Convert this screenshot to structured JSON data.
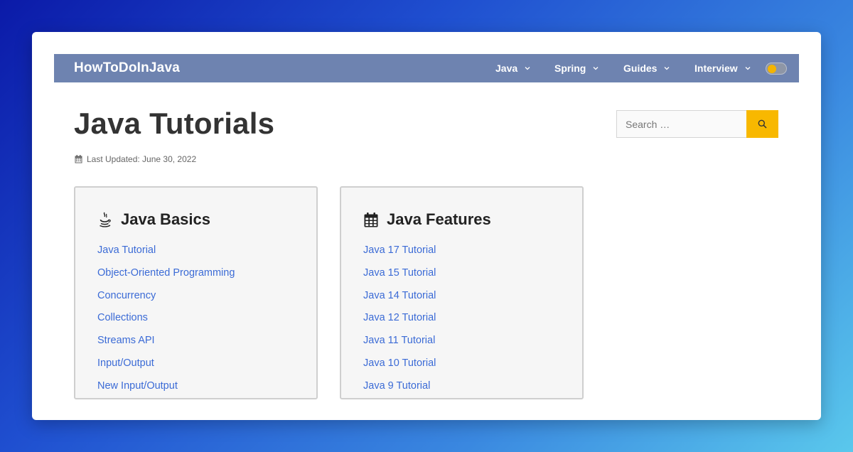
{
  "header": {
    "brand": "HowToDoInJava",
    "nav": [
      {
        "label": "Java"
      },
      {
        "label": "Spring"
      },
      {
        "label": "Guides"
      },
      {
        "label": "Interview"
      }
    ]
  },
  "page": {
    "title": "Java Tutorials",
    "last_updated": "Last Updated: June 30, 2022"
  },
  "search": {
    "placeholder": "Search …"
  },
  "cards": [
    {
      "title": "Java Basics",
      "icon": "java-cup-icon",
      "links": [
        "Java Tutorial",
        "Object-Oriented Programming",
        "Concurrency",
        "Collections",
        "Streams API",
        "Input/Output",
        "New Input/Output"
      ]
    },
    {
      "title": "Java Features",
      "icon": "calendar-icon",
      "links": [
        "Java 17 Tutorial",
        "Java 15 Tutorial",
        "Java 14 Tutorial",
        "Java 12 Tutorial",
        "Java 11 Tutorial",
        "Java 10 Tutorial",
        "Java 9 Tutorial"
      ]
    }
  ],
  "colors": {
    "navbar": "#6e83b0",
    "accent": "#f8b800",
    "link": "#3b6bd6"
  }
}
